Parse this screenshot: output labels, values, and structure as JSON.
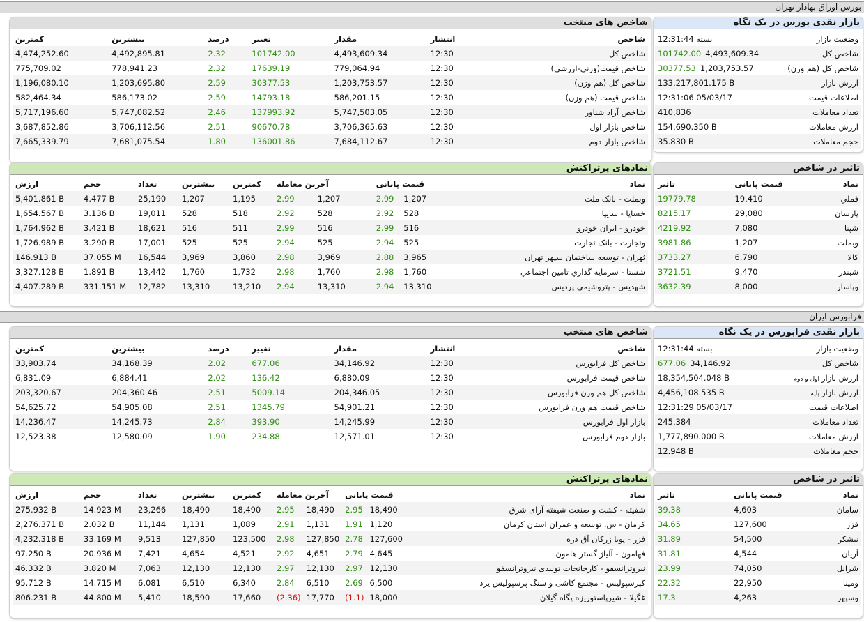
{
  "tehran": {
    "title": "بورس اوراق بهادار تهران",
    "glance": {
      "title": "بازار نقدی بورس در یک نگاه",
      "rows": [
        {
          "label": "وضعیت بازار",
          "value": "بسته 12:31:44",
          "extra": ""
        },
        {
          "label": "شاخص کل",
          "value": "4,493,609.34",
          "extra": "101742.00"
        },
        {
          "label": "شاخص کل (هم وزن)",
          "value": "1,203,753.57",
          "extra": "30377.53"
        },
        {
          "label": "ارزش بازار",
          "value": "133,217,801.175 B",
          "extra": ""
        },
        {
          "label": "اطلاعات قیمت",
          "value": "12:31:06 05/03/17",
          "extra": ""
        },
        {
          "label": "تعداد معاملات",
          "value": "410,836",
          "extra": ""
        },
        {
          "label": "ارزش معاملات",
          "value": "154,690.350 B",
          "extra": ""
        },
        {
          "label": "حجم معاملات",
          "value": "35.830 B",
          "extra": ""
        }
      ]
    },
    "indices": {
      "title": "شاخص های منتخب",
      "headers": [
        "شاخص",
        "انتشار",
        "مقدار",
        "تغییر",
        "درصد",
        "بیشترین",
        "کمترین"
      ],
      "rows": [
        [
          "شاخص کل",
          "12:30",
          "4,493,609.34",
          "101742.00",
          "2.32",
          "4,492,895.81",
          "4,474,252.60"
        ],
        [
          "شاخص قیمت(وزنی-ارزشی)",
          "12:30",
          "779,064.94",
          "17639.19",
          "2.32",
          "778,941.23",
          "775,709.02"
        ],
        [
          "شاخص کل (هم وزن)",
          "12:30",
          "1,203,753.57",
          "30377.53",
          "2.59",
          "1,203,695.80",
          "1,196,080.10"
        ],
        [
          "شاخص قیمت (هم وزن)",
          "12:30",
          "586,201.15",
          "14793.18",
          "2.59",
          "586,173.02",
          "582,464.34"
        ],
        [
          "شاخص آزاد شناور",
          "12:30",
          "5,747,503.05",
          "137993.92",
          "2.46",
          "5,747,082.52",
          "5,717,196.60"
        ],
        [
          "شاخص بازار اول",
          "12:30",
          "3,706,365.63",
          "90670.78",
          "2.51",
          "3,706,112.56",
          "3,687,852.86"
        ],
        [
          "شاخص بازار دوم",
          "12:30",
          "7,684,112.67",
          "136001.86",
          "1.80",
          "7,681,075.54",
          "7,665,339.79"
        ]
      ]
    },
    "impact": {
      "title": "تاثیر در شاخص",
      "headers": [
        "نماد",
        "قیمت پایانی",
        "تاثیر"
      ],
      "rows": [
        [
          "فملي",
          "19,410",
          "19779.78"
        ],
        [
          "پارسان",
          "29,080",
          "8215.17"
        ],
        [
          "شپنا",
          "7,080",
          "4219.92"
        ],
        [
          "وبملت",
          "1,207",
          "3981.86"
        ],
        [
          "کالا",
          "6,790",
          "3733.27"
        ],
        [
          "شبندر",
          "9,470",
          "3721.51"
        ],
        [
          "وپاسار",
          "8,000",
          "3632.39"
        ]
      ]
    },
    "active": {
      "title": "نمادهای پرتراکنش",
      "headers": [
        "نماد",
        "قیمت پایانی",
        "آخرین معامله",
        "کمترین",
        "بیشترین",
        "تعداد",
        "حجم",
        "ارزش"
      ],
      "rows": [
        [
          "وبملت - بانک ملت",
          "1,207",
          "2.99",
          "1,207",
          "2.99",
          "1,195",
          "1,207",
          "25,190",
          "4.477 B",
          "5,401.861 B"
        ],
        [
          "خساپا - سايپا",
          "528",
          "2.92",
          "528",
          "2.92",
          "518",
          "528",
          "19,011",
          "3.136 B",
          "1,654.567 B"
        ],
        [
          "خودرو - ايران خودرو",
          "516",
          "2.99",
          "516",
          "2.99",
          "511",
          "516",
          "18,621",
          "3.421 B",
          "1,764.962 B"
        ],
        [
          "وتجارت - بانک تجارت",
          "525",
          "2.94",
          "525",
          "2.94",
          "525",
          "525",
          "17,001",
          "3.290 B",
          "1,726.989 B"
        ],
        [
          "ثهران - توسعه ساختمان سپهر تهران",
          "3,965",
          "2.88",
          "3,969",
          "2.98",
          "3,860",
          "3,969",
          "16,544",
          "37.055 M",
          "146.913 B"
        ],
        [
          "شستا - سرمايه گذاري تامين اجتماعي",
          "1,760",
          "2.98",
          "1,760",
          "2.98",
          "1,732",
          "1,760",
          "13,442",
          "1.891 B",
          "3,327.128 B"
        ],
        [
          "شهديس - پتروشيمي پرديس",
          "13,310",
          "2.94",
          "13,310",
          "2.94",
          "13,210",
          "13,310",
          "12,782",
          "331.151 M",
          "4,407.289 B"
        ]
      ]
    }
  },
  "farabourse": {
    "title": "فرابورس ایران",
    "glance": {
      "title": "بازار نقدی فرابورس در یک نگاه",
      "rows": [
        {
          "label": "وضعیت بازار",
          "value": "بسته 12:31:44",
          "extra": "",
          "small": ""
        },
        {
          "label": "شاخص کل",
          "value": "34,146.92",
          "extra": "677.06",
          "small": ""
        },
        {
          "label": "ارزش بازار",
          "value": "18,354,504.048 B",
          "extra": "",
          "small": "اول و دوم"
        },
        {
          "label": "ارزش بازار",
          "value": "4,456,108.535 B",
          "extra": "",
          "small": "پایه"
        },
        {
          "label": "اطلاعات قیمت",
          "value": "12:31:29 05/03/17",
          "extra": "",
          "small": ""
        },
        {
          "label": "تعداد معاملات",
          "value": "245,384",
          "extra": "",
          "small": ""
        },
        {
          "label": "ارزش معاملات",
          "value": "1,777,890.000 B",
          "extra": "",
          "small": ""
        },
        {
          "label": "حجم معاملات",
          "value": "12.948 B",
          "extra": "",
          "small": ""
        }
      ]
    },
    "indices": {
      "title": "شاخص های منتخب",
      "headers": [
        "شاخص",
        "انتشار",
        "مقدار",
        "تغییر",
        "درصد",
        "بیشترین",
        "کمترین"
      ],
      "rows": [
        [
          "شاخص کل فرابورس",
          "12:30",
          "34,146.92",
          "677.06",
          "2.02",
          "34,168.39",
          "33,903.74"
        ],
        [
          "شاخص قیمت فرابورس",
          "12:30",
          "6,880.09",
          "136.42",
          "2.02",
          "6,884.41",
          "6,831.09"
        ],
        [
          "شاخص کل هم وزن فرابورس",
          "12:30",
          "204,346.05",
          "5009.14",
          "2.51",
          "204,360.46",
          "203,320.67"
        ],
        [
          "شاخص قیمت هم وزن فرابورس",
          "12:30",
          "54,901.21",
          "1345.79",
          "2.51",
          "54,905.08",
          "54,625.72"
        ],
        [
          "بازار اول فرابورس",
          "12:30",
          "14,245.99",
          "393.90",
          "2.84",
          "14,245.73",
          "14,236.47"
        ],
        [
          "بازار دوم فرابورس",
          "12:30",
          "12,571.01",
          "234.88",
          "1.90",
          "12,580.09",
          "12,523.38"
        ]
      ]
    },
    "impact": {
      "title": "تاثیر در شاخص",
      "headers": [
        "نماد",
        "قیمت پایانی",
        "تاثیر"
      ],
      "rows": [
        [
          "سامان",
          "4,603",
          "39.38"
        ],
        [
          "فزر",
          "127,600",
          "34.65"
        ],
        [
          "نیشکر",
          "54,500",
          "31.89"
        ],
        [
          "آریان",
          "4,544",
          "31.81"
        ],
        [
          "شرانل",
          "74,050",
          "23.99"
        ],
        [
          "ومينا",
          "22,950",
          "22.32"
        ],
        [
          "وسپهر",
          "4,263",
          "17.3"
        ]
      ]
    },
    "active": {
      "title": "نمادهای پرتراکنش",
      "headers": [
        "نماد",
        "قیمت پایانی",
        "آخرین معامله",
        "کمترین",
        "بیشترین",
        "تعداد",
        "حجم",
        "ارزش"
      ],
      "rows": [
        [
          "شفیته - کشت و صنعت شیفته آرای شرق",
          "18,490",
          "2.95",
          "18,490",
          "2.95",
          "18,490",
          "18,490",
          "23,266",
          "14.923 M",
          "275.932 B"
        ],
        [
          "کرمان - س. توسعه و عمران استان کرمان",
          "1,120",
          "1.91",
          "1,131",
          "2.91",
          "1,089",
          "1,131",
          "11,144",
          "2.032 B",
          "2,276.371 B"
        ],
        [
          "فزر - پویا زرکان آق دره",
          "127,600",
          "2.78",
          "127,850",
          "2.98",
          "123,500",
          "127,850",
          "9,513",
          "33.169 M",
          "4,232.318 B"
        ],
        [
          "فهامون - آلیاژ گستر هامون",
          "4,645",
          "2.79",
          "4,651",
          "2.92",
          "4,521",
          "4,654",
          "7,421",
          "20.936 M",
          "97.250 B"
        ],
        [
          "نیروترانسفو - کارخانجات تولیدی نیروترانسفو",
          "12,130",
          "2.97",
          "12,130",
          "2.97",
          "12,130",
          "12,130",
          "7,063",
          "3.820 M",
          "46.332 B"
        ],
        [
          "کپرسپولیس - مجتمع کاشی و سنگ پرسپولیس یزد",
          "6,500",
          "2.69",
          "6,510",
          "2.84",
          "6,340",
          "6,510",
          "6,081",
          "14.715 M",
          "95.712 B"
        ],
        [
          "غگیلا - شیرپاستوریزه پگاه گیلان",
          "18,000",
          "(1.1)",
          "17,770",
          "(2.36)",
          "17,660",
          "18,590",
          "5,410",
          "44.800 M",
          "806.231 B"
        ]
      ]
    }
  }
}
